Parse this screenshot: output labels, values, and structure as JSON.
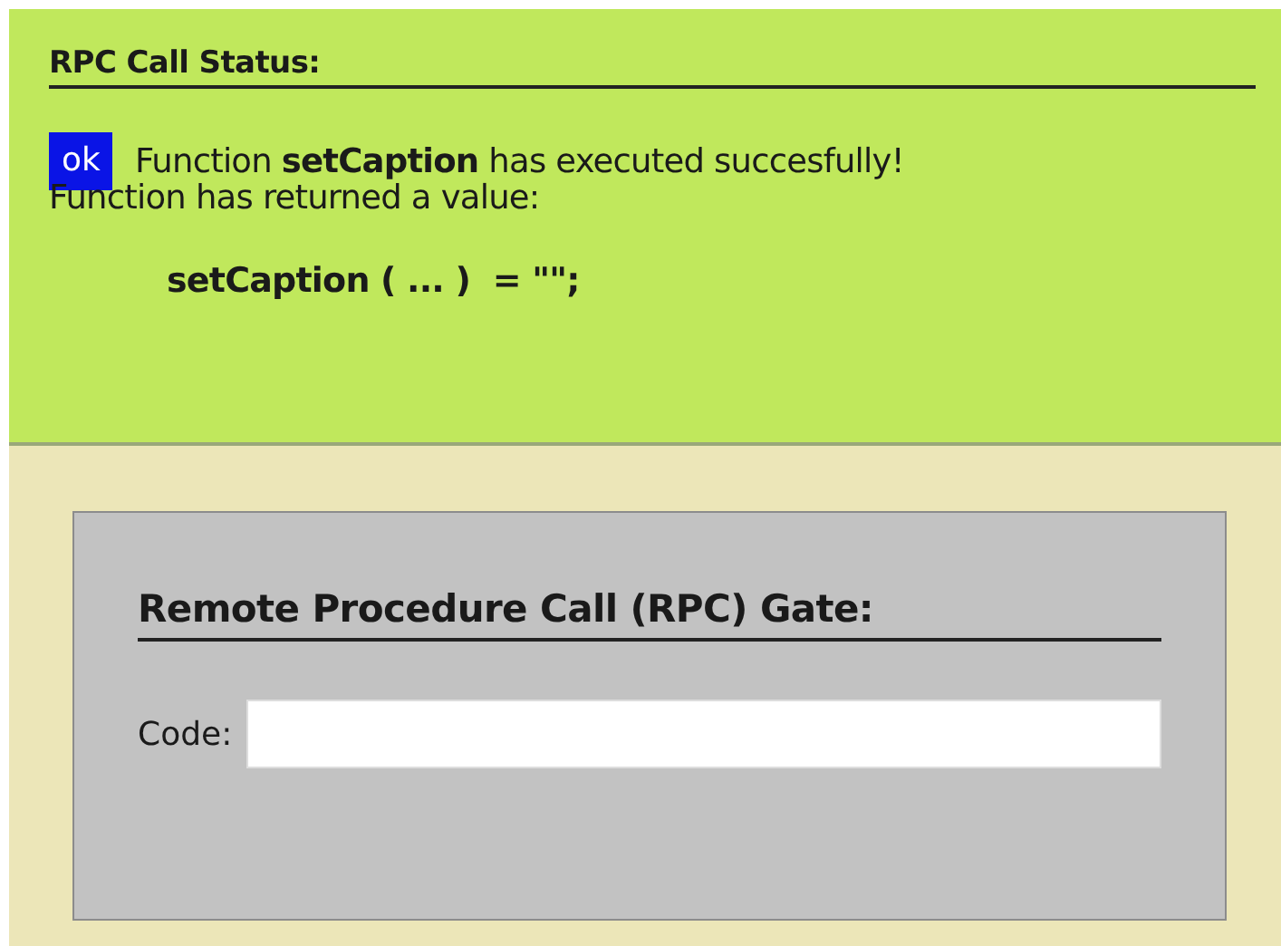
{
  "status_panel": {
    "title": "RPC Call Status:",
    "status": {
      "label": "ok",
      "kind": "success"
    },
    "message": "Function **setCaption** has executed succesfully!",
    "detail": "Function has returned a value:",
    "result": "setCaption ( ... )  = \"\";"
  },
  "gate_panel": {
    "title": "Remote Procedure Call (RPC) Gate:",
    "code_field": {
      "label": "Code:"
    }
  }
}
